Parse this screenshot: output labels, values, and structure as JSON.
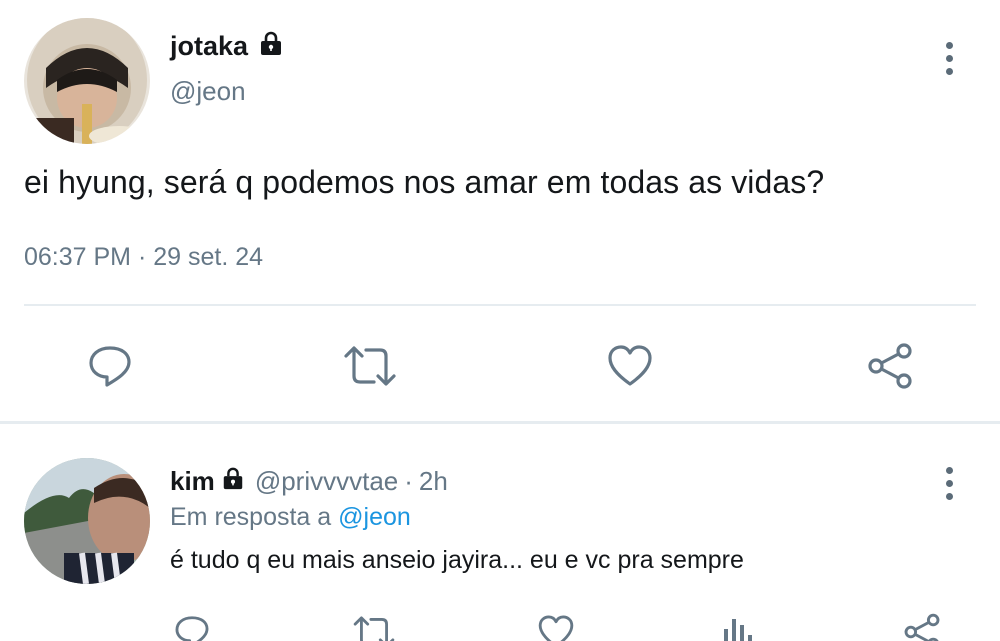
{
  "main_tweet": {
    "display_name": "jotaka",
    "handle": "@jeon",
    "text": "ei hyung, será q podemos nos amar em todas as vidas?",
    "timestamp": "06:37 PM · 29 set. 24"
  },
  "reply": {
    "display_name": "kim",
    "handle": "@privvvvtae",
    "separator": "·",
    "time_ago": "2h",
    "replying_prefix": "Em resposta a",
    "replying_to": "@jeon",
    "text": "é tudo q eu mais anseio jayira... eu e vc pra sempre"
  },
  "colors": {
    "icon_gray": "#657786",
    "mention_blue": "#1b95e0",
    "divider": "#e6ecf0"
  }
}
